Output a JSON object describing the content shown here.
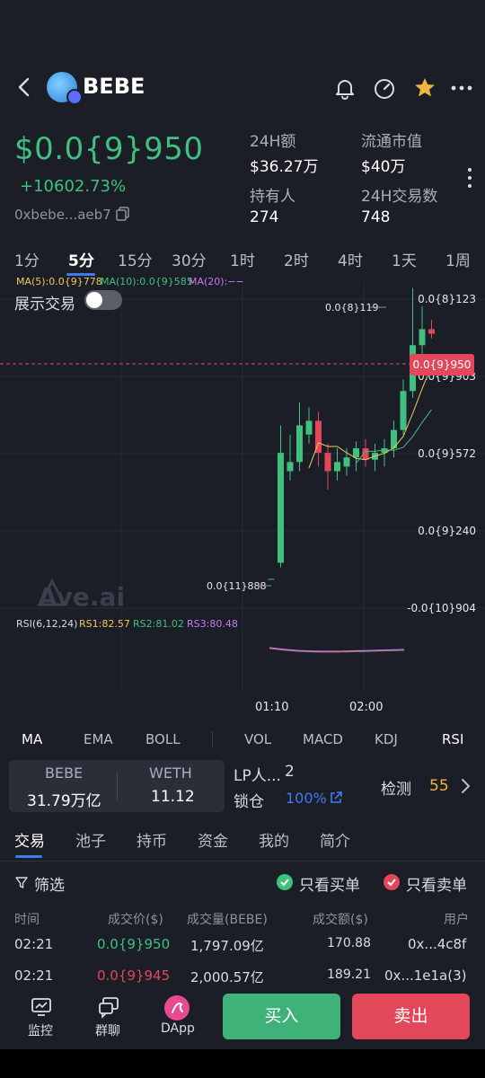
{
  "header": {
    "title": "BEBE",
    "icons": [
      "back-arrow-icon",
      "token-logo",
      "bell-icon",
      "gauge-icon",
      "star-icon",
      "more-icon"
    ]
  },
  "token": {
    "price": "$0.0{9}950",
    "change": "+10602.73%",
    "address": "0xbebe...aeb7"
  },
  "stats": {
    "vol24_label": "24H额",
    "vol24": "$36.27万",
    "mcap_label": "流通市值",
    "mcap": "$40万",
    "holders_label": "持有人",
    "holders": "274",
    "tx24_label": "24H交易数",
    "tx24": "748"
  },
  "timeframes": [
    "1分",
    "5分",
    "15分",
    "30分",
    "1时",
    "2时",
    "4时",
    "1天",
    "1周"
  ],
  "active_timeframe": "5分",
  "ma": {
    "ma5": "MA(5):0.0{9}778",
    "ma10": "MA(10):0.0{9}585",
    "ma20": "MA(20):−−"
  },
  "toggle_label": "展示交易",
  "chart_data": {
    "type": "candlestick",
    "price_axis_labels": [
      "0.0{8}123",
      "0.0{9}903",
      "0.0{9}572",
      "0.0{9}240",
      "-0.0{10}904"
    ],
    "high_label": "0.0{8}119",
    "low_label": "0.0{11}888",
    "current_price_tag": "0.0{9}950",
    "time_labels": [
      "01:10",
      "02:00"
    ],
    "watermark": "Ave.ai",
    "rsi": {
      "title": "RSI(6,12,24)",
      "rs1": "RS1:82.57",
      "rs2": "RS2:81.02",
      "rs3": "RS3:80.48"
    },
    "candles": [
      {
        "o": 0.03,
        "c": 0.03,
        "h": 0.03,
        "l": 0.03
      },
      {
        "o": 0.1,
        "c": 0.58,
        "h": 0.7,
        "l": 0.08
      },
      {
        "o": 0.5,
        "c": 0.54,
        "h": 0.66,
        "l": 0.46
      },
      {
        "o": 0.54,
        "c": 0.7,
        "h": 0.8,
        "l": 0.5
      },
      {
        "o": 0.66,
        "c": 0.72,
        "h": 0.78,
        "l": 0.62
      },
      {
        "o": 0.72,
        "c": 0.58,
        "h": 0.76,
        "l": 0.52
      },
      {
        "o": 0.58,
        "c": 0.5,
        "h": 0.62,
        "l": 0.42
      },
      {
        "o": 0.5,
        "c": 0.54,
        "h": 0.6,
        "l": 0.46
      },
      {
        "o": 0.52,
        "c": 0.56,
        "h": 0.6,
        "l": 0.48
      },
      {
        "o": 0.56,
        "c": 0.6,
        "h": 0.63,
        "l": 0.5
      },
      {
        "o": 0.6,
        "c": 0.55,
        "h": 0.64,
        "l": 0.52
      },
      {
        "o": 0.55,
        "c": 0.58,
        "h": 0.62,
        "l": 0.5
      },
      {
        "o": 0.58,
        "c": 0.6,
        "h": 0.64,
        "l": 0.52
      },
      {
        "o": 0.6,
        "c": 0.68,
        "h": 0.72,
        "l": 0.56
      },
      {
        "o": 0.68,
        "c": 0.85,
        "h": 0.9,
        "l": 0.66
      },
      {
        "o": 0.85,
        "c": 1.05,
        "h": 1.3,
        "l": 0.82
      },
      {
        "o": 1.05,
        "c": 1.12,
        "h": 1.22,
        "l": 1.0
      },
      {
        "o": 1.12,
        "c": 1.1,
        "h": 1.16,
        "l": 1.08
      }
    ]
  },
  "indicators": [
    "MA",
    "EMA",
    "BOLL",
    "VOL",
    "MACD",
    "KDJ",
    "RSI"
  ],
  "pair": {
    "base_name": "BEBE",
    "base_amount": "31.79万亿",
    "quote_name": "WETH",
    "quote_amount": "11.12",
    "lp_label": "LP人...",
    "lp_value": "2",
    "lock_label": "锁仓",
    "lock_value": "100%",
    "detect_label": "检测",
    "detect_score": "55"
  },
  "tabs": [
    "交易",
    "池子",
    "持币",
    "资金",
    "我的",
    "简介"
  ],
  "filter": {
    "label": "筛选",
    "buy_only": "只看买单",
    "sell_only": "只看卖单"
  },
  "trades": {
    "headers": [
      "时间",
      "成交价($)",
      "成交量(BEBE)",
      "成交额($)",
      "用户"
    ],
    "rows": [
      {
        "time": "02:21",
        "price": "0.0{9}950",
        "qty": "1,797.09亿",
        "amount": "170.88",
        "user": "0x...4c8f",
        "side": "buy"
      },
      {
        "time": "02:21",
        "price": "0.0{9}945",
        "qty": "2,000.57亿",
        "amount": "189.21",
        "user": "0x...1e1a(3)",
        "side": "sell"
      }
    ]
  },
  "bottom": {
    "monitor": "监控",
    "group_chat": "群聊",
    "dapp": "DApp",
    "buy": "买入",
    "sell": "卖出"
  },
  "colors": {
    "background": "#1b1e27",
    "up": "#3fc07f",
    "down": "#e3475a",
    "accent": "#3d7bf0",
    "ma5": "#f0c85a",
    "ma10": "#3fc07f",
    "ma20": "#c87af0"
  }
}
